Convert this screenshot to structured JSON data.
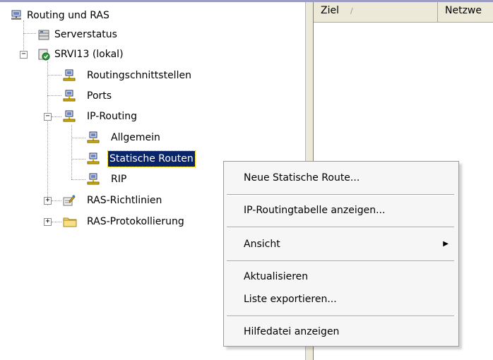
{
  "tree": {
    "root": {
      "label": "Routing und RAS"
    },
    "server_status": {
      "label": "Serverstatus"
    },
    "server": {
      "label": "SRVI13 (lokal)",
      "expander": "−"
    },
    "routing_interfaces": {
      "label": "Routingschnittstellen"
    },
    "ports": {
      "label": "Ports"
    },
    "ip_routing": {
      "label": "IP-Routing",
      "expander": "−"
    },
    "general": {
      "label": "Allgemein"
    },
    "static_routes": {
      "label": "Statische Routen",
      "selected": true
    },
    "rip": {
      "label": "RIP"
    },
    "ras_policies": {
      "label": "RAS-Richtlinien",
      "expander": "+"
    },
    "ras_logging": {
      "label": "RAS-Protokollierung",
      "expander": "+"
    }
  },
  "list": {
    "columns": [
      {
        "label": "Ziel",
        "sort_glyph": "/"
      },
      {
        "label": "Netzwe"
      }
    ]
  },
  "context_menu": {
    "items": [
      {
        "label": "Neue Statische Route..."
      },
      {
        "label": "IP-Routingtabelle anzeigen..."
      },
      {
        "label": "Ansicht",
        "submenu_arrow": "▶"
      },
      {
        "label": "Aktualisieren"
      },
      {
        "label": "Liste exportieren..."
      },
      {
        "label": "Hilfedatei anzeigen"
      }
    ]
  },
  "colors": {
    "selection": "#0a246a",
    "menu_bg": "#f6f6f6",
    "header_bg": "#ece9d8"
  }
}
